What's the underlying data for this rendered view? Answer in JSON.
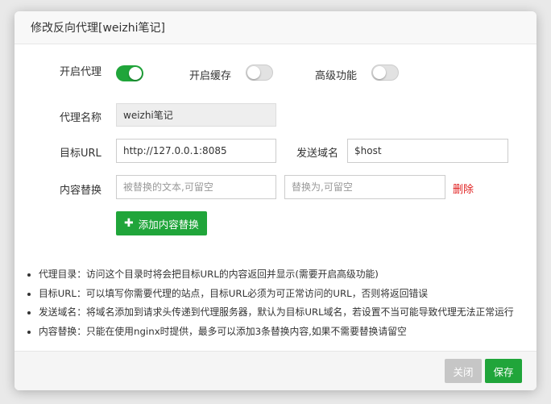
{
  "dialog": {
    "title": "修改反向代理[weizhi笔记]"
  },
  "form": {
    "enable_proxy": {
      "label": "开启代理",
      "on": true
    },
    "enable_cache": {
      "label": "开启缓存",
      "on": false
    },
    "advanced": {
      "label": "高级功能",
      "on": false
    },
    "proxy_name": {
      "label": "代理名称",
      "value": "weizhi笔记"
    },
    "target_url": {
      "label": "目标URL",
      "value": "http://127.0.0.1:8085"
    },
    "send_domain": {
      "label": "发送域名",
      "value": "$host"
    },
    "content_replace": {
      "label": "内容替换",
      "from_placeholder": "被替换的文本,可留空",
      "to_placeholder": "替换为,可留空",
      "delete_label": "删除"
    },
    "add_replace_button": "添加内容替换"
  },
  "tips": [
    "代理目录：访问这个目录时将会把目标URL的内容返回并显示(需要开启高级功能)",
    "目标URL：可以填写你需要代理的站点，目标URL必须为可正常访问的URL，否则将返回错误",
    "发送域名：将域名添加到请求头传递到代理服务器，默认为目标URL域名，若设置不当可能导致代理无法正常运行",
    "内容替换：只能在使用nginx时提供，最多可以添加3条替换内容,如果不需要替换请留空"
  ],
  "footer": {
    "close_label": "关闭",
    "save_label": "保存"
  },
  "colors": {
    "primary": "#20a53a",
    "danger": "#e02020",
    "disabled": "#c6c6c6"
  }
}
